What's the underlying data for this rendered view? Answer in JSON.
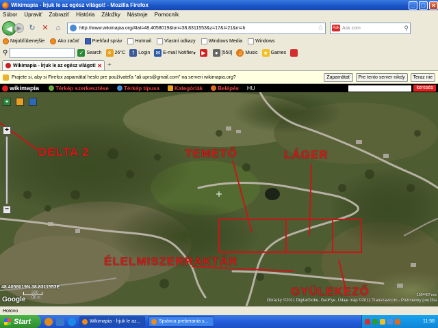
{
  "window": {
    "title": "Wikimapia - Írjuk le az egész világot! - Mozilla Firefox",
    "minimize": "_",
    "maximize": "□",
    "close": "×"
  },
  "menu": [
    "Súbor",
    "Upraviť",
    "Zobraziť",
    "História",
    "Záložky",
    "Nástroje",
    "Pomocník"
  ],
  "nav": {
    "url": "http://www.wikimapia.org/#lat=48.4058019&lon=38.8311553&z=17&l=21&m=h",
    "search_engine": "Ask",
    "search_placeholder": "Ask.com"
  },
  "bookmarks": [
    {
      "label": "Najobľúbenejšie",
      "icon": "fire"
    },
    {
      "label": "Ako začať",
      "icon": "fire"
    },
    {
      "label": "Prehľad správ",
      "icon": "sk"
    },
    {
      "label": "Hotmail",
      "icon": "doc"
    },
    {
      "label": "Vlastní odkazy",
      "icon": "doc"
    },
    {
      "label": "Windows Media",
      "icon": "doc"
    },
    {
      "label": "Windows",
      "icon": "doc"
    }
  ],
  "toolbar": {
    "items": [
      {
        "label": "Search",
        "icon": "search-icon",
        "color": "#2a8a3a"
      },
      {
        "label": "26°C",
        "icon": "weather-icon",
        "color": "#e8a020"
      },
      {
        "label": "Login",
        "icon": "facebook-icon",
        "color": "#3b5998"
      },
      {
        "label": "E-mail Notifier",
        "icon": "email-icon",
        "color": "#2a5aa8"
      },
      {
        "label": "",
        "icon": "youtube-icon",
        "color": "#d22020"
      },
      {
        "label": "[550]",
        "icon": "counter-icon",
        "color": "#666666"
      },
      {
        "label": "Music",
        "icon": "music-icon",
        "color": "#e07a10"
      },
      {
        "label": "Games",
        "icon": "games-icon",
        "color": "#f0c020"
      }
    ]
  },
  "tabs": [
    {
      "label": "Wikimapia - Írjuk le az egész világot!"
    }
  ],
  "notification": {
    "message": "Prajete si, aby si Firefox zapamätal heslo pre používateľa \"ali.uprs@gmail.com\" na serveri wikimapia.org?",
    "buttons": [
      "Zapamätať",
      "Pre tento server nikdy",
      "Teraz nie"
    ]
  },
  "wikimapia": {
    "logo": "wikimapia",
    "nav": [
      "Térkép szerkesztése",
      "Térkép típusa",
      "Kategóriák",
      "Belépés"
    ],
    "lang": "HU",
    "search_button": "keresés"
  },
  "map": {
    "labels": {
      "delta": "DELTA  2",
      "temeto": "TEMETŐ",
      "lager": "LÁGER",
      "elelmiszer": "ÉLELMISZERRAKTÁR",
      "gyulekezo": "GYÜLEKEZŐ"
    },
    "coordinates": "48.4058019N 38.8311553E",
    "scale_m": "200 m",
    "scale_ft": "50 m",
    "zoom_info": "1604407 m/s",
    "copyright": "Obrázky ©2011 DigitalGlobe, GeoEye, Údaje máp ©2011 Transnavicom - Podmienky použitia",
    "google": "Google",
    "zoom_in": "+",
    "zoom_out": "−"
  },
  "status": "Hotovo",
  "taskbar": {
    "start": "Start",
    "tasks": [
      {
        "label": "Wikimapia - Írjuk le az...",
        "active": true
      },
      {
        "label": "Správca preberania s...",
        "active": false
      }
    ],
    "clock": "11:58"
  }
}
